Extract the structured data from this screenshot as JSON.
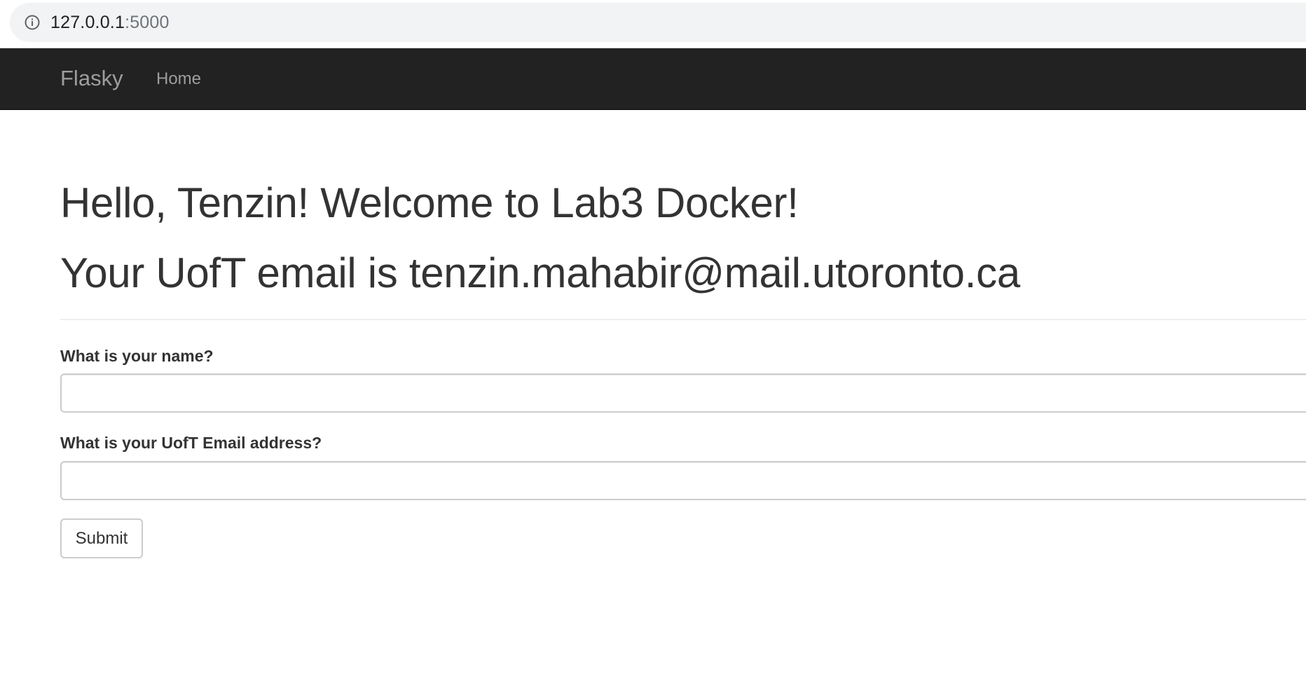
{
  "browser": {
    "url_host": "127.0.0.1",
    "url_port": ":5000",
    "info_icon": "info-circle-icon"
  },
  "navbar": {
    "brand": "Flasky",
    "items": [
      {
        "label": "Home"
      }
    ]
  },
  "main": {
    "greeting": "Hello, Tenzin! Welcome to Lab3 Docker!",
    "email_line": "Your UofT email is tenzin.mahabir@mail.utoronto.ca"
  },
  "form": {
    "name_label": "What is your name?",
    "name_value": "",
    "email_label": "What is your UofT Email address?",
    "email_value": "",
    "submit_label": "Submit"
  },
  "colors": {
    "navbar_bg": "#222222",
    "navbar_text": "#9d9d9d",
    "text": "#333333",
    "address_bar_bg": "#f1f3f4"
  }
}
